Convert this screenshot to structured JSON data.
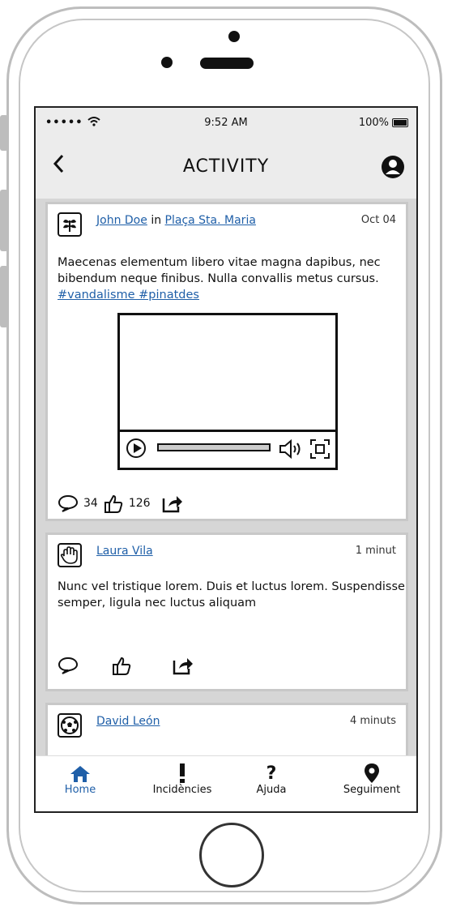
{
  "status_bar": {
    "signal": "•••••",
    "time": "9:52 AM",
    "battery": "100%"
  },
  "header": {
    "title": "ACTIVITY"
  },
  "posts": [
    {
      "author": "John Doe",
      "connector": "in",
      "location": "Plaça Sta. Maria",
      "date": "Oct 04",
      "text": "Maecenas elementum libero vitae magna dapibus, nec bibendum neque finibus. Nulla convallis metus cursus.",
      "tags": "#vandalisme #pinatdes",
      "comments": "34",
      "likes": "126"
    },
    {
      "author": "Laura Vila",
      "date": "1 minut",
      "text": "Nunc vel tristique lorem. Duis et luctus lorem. Suspendisse semper, ligula nec luctus aliquam"
    },
    {
      "author": "David León",
      "date": "4 minuts"
    }
  ],
  "tabs": [
    {
      "label": "Home",
      "icon": "home-icon",
      "active": true
    },
    {
      "label": "Incidències",
      "icon": "exclamation-icon",
      "active": false
    },
    {
      "label": "Ajuda",
      "icon": "question-icon",
      "active": false
    },
    {
      "label": "Seguiment",
      "icon": "map-pin-icon",
      "active": false
    }
  ],
  "colors": {
    "accent": "#1f5fa8",
    "header_bg": "#ececec",
    "feed_bg": "#d6d6d6"
  }
}
